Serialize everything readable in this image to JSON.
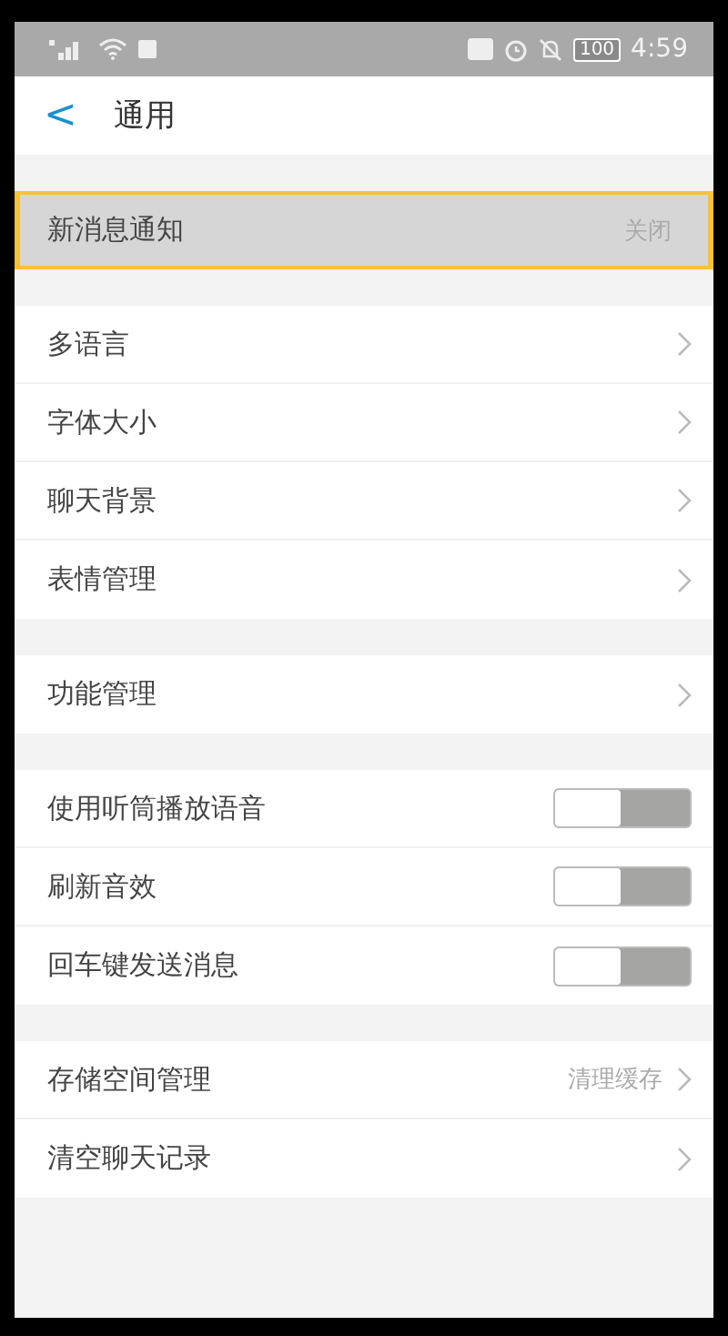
{
  "status_bar": {
    "time": "4:59",
    "battery": "100"
  },
  "header": {
    "back": "<",
    "title": "通用"
  },
  "sections": [
    {
      "rows": [
        {
          "kind": "nav",
          "label": "新消息通知",
          "value": "关闭",
          "highlighted": true
        }
      ]
    },
    {
      "rows": [
        {
          "kind": "nav",
          "label": "多语言",
          "highlighted": false
        },
        {
          "kind": "nav",
          "label": "字体大小",
          "highlighted": false
        },
        {
          "kind": "nav",
          "label": "聊天背景",
          "highlighted": false
        },
        {
          "kind": "nav",
          "label": "表情管理",
          "highlighted": false
        }
      ]
    },
    {
      "rows": [
        {
          "kind": "nav",
          "label": "功能管理",
          "highlighted": false
        }
      ]
    },
    {
      "rows": [
        {
          "kind": "toggle",
          "label": "使用听筒播放语音",
          "on": false
        },
        {
          "kind": "toggle",
          "label": "刷新音效",
          "on": false
        },
        {
          "kind": "toggle",
          "label": "回车键发送消息",
          "on": false
        }
      ]
    },
    {
      "rows": [
        {
          "kind": "nav",
          "label": "存储空间管理",
          "value": "清理缓存",
          "highlighted": false
        },
        {
          "kind": "nav",
          "label": "清空聊天记录",
          "highlighted": false
        }
      ]
    }
  ]
}
